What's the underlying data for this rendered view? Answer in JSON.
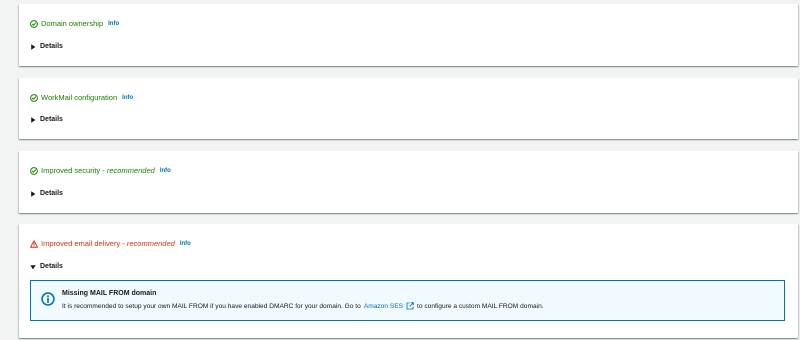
{
  "sections": [
    {
      "title": "Domain ownership",
      "recommended": "",
      "status": "success",
      "info": "Info",
      "details": "Details",
      "expanded": false
    },
    {
      "title": "WorkMail configuration",
      "recommended": "",
      "status": "success",
      "info": "Info",
      "details": "Details",
      "expanded": false
    },
    {
      "title": "Improved security - ",
      "recommended": "recommended",
      "status": "success",
      "info": "Info",
      "details": "Details",
      "expanded": false
    },
    {
      "title": "Improved email delivery - ",
      "recommended": "recommended",
      "status": "warning",
      "info": "Info",
      "details": "Details",
      "expanded": true
    }
  ],
  "alert": {
    "title": "Missing MAIL FROM domain",
    "body_before": "It is recommended to setup your own MAIL FROM if you have enabled DMARC for your domain. Go to",
    "link": "Amazon SES",
    "body_after": "to configure a custom MAIL FROM domain."
  },
  "colors": {
    "success": "#1d8102",
    "error": "#d13212",
    "link": "#0073bb",
    "alert_bg": "#f1faff"
  },
  "icons": {
    "success": "check-circle-icon",
    "warning": "warning-triangle-icon",
    "collapsed": "caret-right-icon",
    "expanded": "caret-down-icon",
    "alert": "info-circle-icon",
    "external": "external-link-icon"
  }
}
